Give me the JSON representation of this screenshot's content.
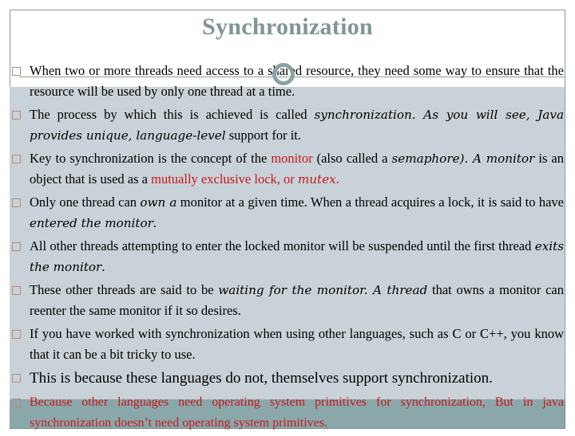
{
  "slide": {
    "title": "Synchronization",
    "accent_color": "#c8161d",
    "title_color": "#7f9597",
    "bullets": [
      {
        "parts": [
          "When two or more threads need access to a shared resource, they need some way to ensure that the resource will be used by only one thread at a time."
        ]
      },
      {
        "parts": [
          "The process by which this is achieved is called ",
          "synchronization. As you will see, Java provides unique, language-level",
          " support for it."
        ]
      },
      {
        "parts": [
          "Key to synchronization is the concept of the ",
          "monitor",
          " (also called a ",
          "semaphore). A monitor",
          " is an object that is used as a ",
          "mutually exclusive lock, or ",
          "mutex",
          "."
        ]
      },
      {
        "parts": [
          "Only one thread can ",
          "own a",
          " monitor at a given time. When a thread acquires a lock, it is said to have ",
          "entered the monitor",
          "."
        ]
      },
      {
        "parts": [
          "All other threads attempting to enter the locked monitor will be suspended until the first thread ",
          "exits the monitor",
          "."
        ]
      },
      {
        "parts": [
          "These other threads are said to be ",
          "waiting for the monitor. A thread",
          " that owns a monitor can reenter the same monitor if it so desires."
        ]
      },
      {
        "parts": [
          "If you have worked with synchronization when using other languages, such as C or C++, you know that it can be a bit tricky to use."
        ]
      },
      {
        "parts": [
          "This is because these languages do not, themselves support synchronization."
        ]
      },
      {
        "parts": [
          "Because other languages need operating system primitives for synchronization, But in java synchronization doesn’t need operating system primitives."
        ]
      }
    ]
  }
}
